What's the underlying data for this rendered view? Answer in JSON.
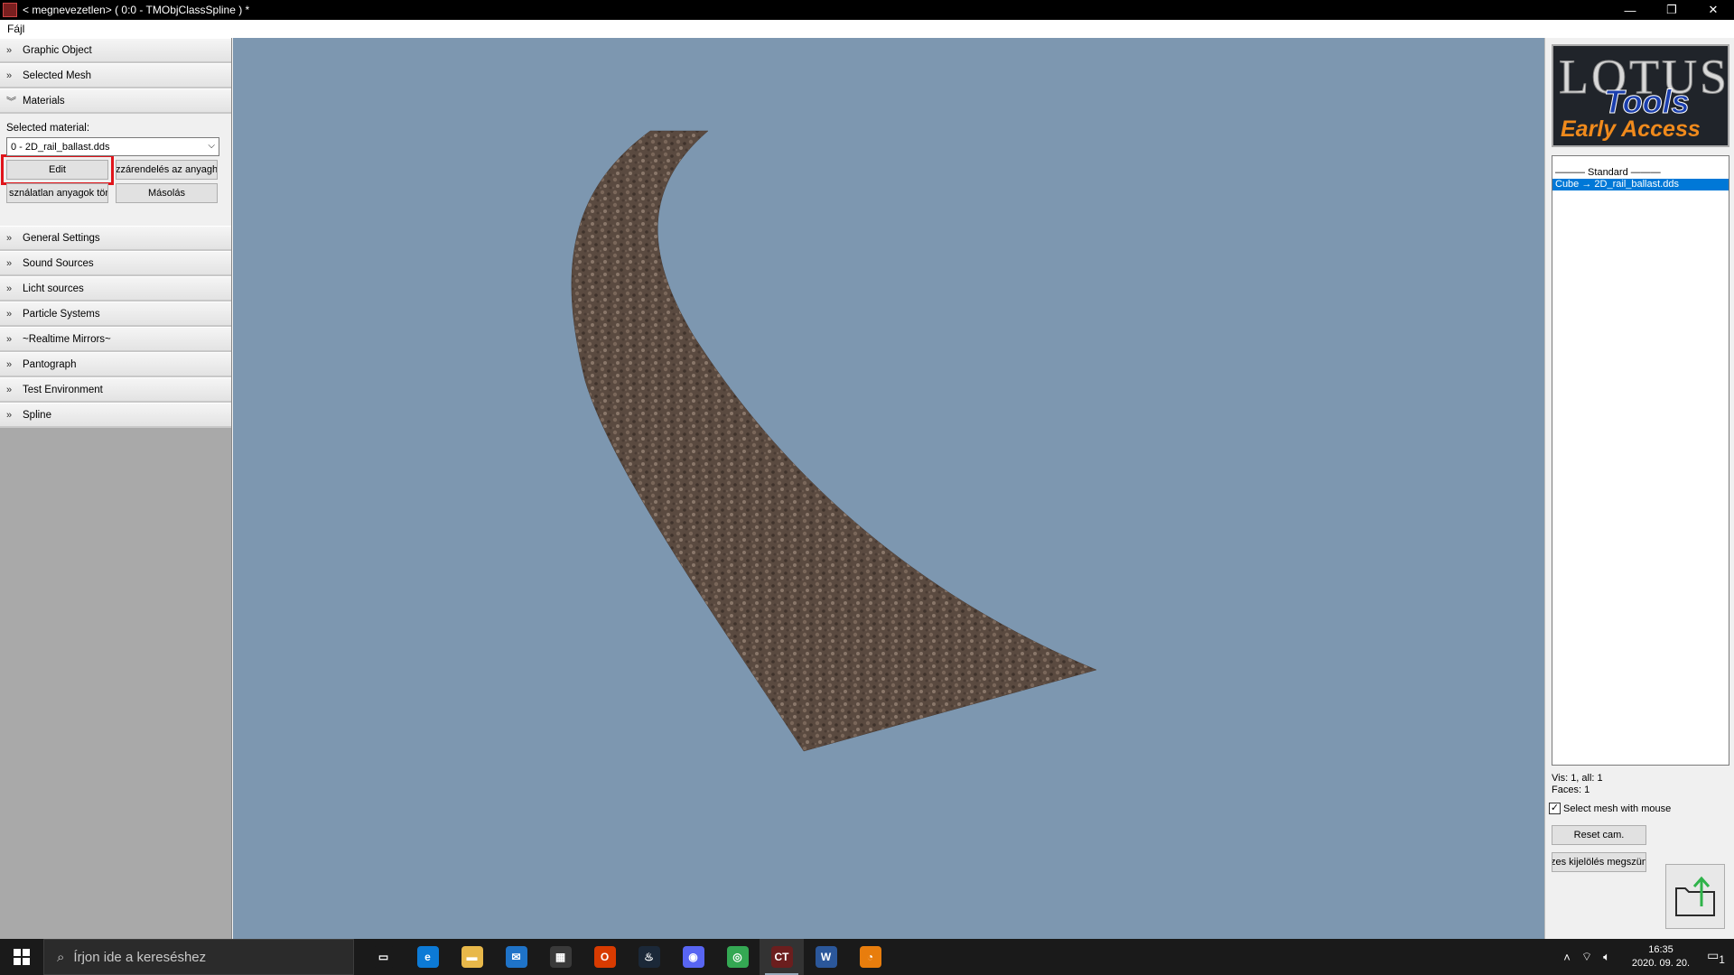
{
  "window": {
    "title": "< megnevezetlen> ( 0:0 - TMObjClassSpline ) *",
    "minimize": "—",
    "restore": "❐",
    "close": "✕"
  },
  "menu": {
    "file": "Fájl"
  },
  "left_panel": {
    "sections_top": [
      {
        "label": "Graphic Object"
      },
      {
        "label": "Selected Mesh"
      },
      {
        "label": "Materials"
      }
    ],
    "materials": {
      "selected_material_label": "Selected material:",
      "selected_material_value": "0 - 2D_rail_ballast.dds",
      "edit_button": "Edit",
      "assign_button": "zzárendelés az anyagh",
      "delete_unused_button": "sználatlan anyagok tör",
      "copy_button": "Másolás"
    },
    "sections_bottom": [
      {
        "label": "General Settings"
      },
      {
        "label": "Sound Sources"
      },
      {
        "label": "Licht sources"
      },
      {
        "label": "Particle Systems"
      },
      {
        "label": "~Realtime Mirrors~"
      },
      {
        "label": "Pantograph"
      },
      {
        "label": "Test Environment"
      },
      {
        "label": "Spline"
      }
    ]
  },
  "right_panel": {
    "logo_text": "LOTUS",
    "logo_tools": "Tools",
    "logo_early": "Early Access",
    "mesh_list": [
      {
        "text": "——— Standard ———",
        "selected": false
      },
      {
        "text": "Cube → 2D_rail_ballast.dds",
        "selected": true
      }
    ],
    "vis_line": "Vis: 1, all: 1",
    "faces_line": "Faces: 1",
    "select_mesh_checkbox": "Select mesh with mouse",
    "reset_cam_button": "Reset cam.",
    "clear_selection_button": "zes kijelölés megszün"
  },
  "taskbar": {
    "search_placeholder": "Írjon ide a kereséshez",
    "time": "16:35",
    "date": "2020. 09. 20.",
    "notification_count": "1",
    "apps": [
      {
        "icon": "task-view-icon",
        "color": "#1a1a1a",
        "glyph": "▭"
      },
      {
        "icon": "edge-icon",
        "color": "#0c7ad6",
        "glyph": "e"
      },
      {
        "icon": "file-explorer-icon",
        "color": "#e8b84a",
        "glyph": "▬"
      },
      {
        "icon": "mail-icon",
        "color": "#1f73c8",
        "glyph": "✉"
      },
      {
        "icon": "store-icon",
        "color": "#3a3a3a",
        "glyph": "▦"
      },
      {
        "icon": "office-icon",
        "color": "#d83b01",
        "glyph": "O"
      },
      {
        "icon": "steam-icon",
        "color": "#1b2838",
        "glyph": "♨"
      },
      {
        "icon": "discord-icon",
        "color": "#5865f2",
        "glyph": "◉"
      },
      {
        "icon": "chrome-icon",
        "color": "#34a853",
        "glyph": "◎"
      },
      {
        "icon": "content-tool-icon",
        "color": "#6b1e1e",
        "glyph": "CT"
      },
      {
        "icon": "word-icon",
        "color": "#2b579a",
        "glyph": "W"
      },
      {
        "icon": "blender-icon",
        "color": "#e87d0d",
        "glyph": "◔"
      }
    ]
  }
}
